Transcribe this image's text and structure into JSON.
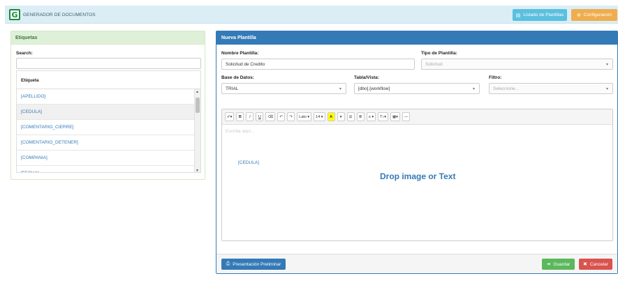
{
  "header": {
    "logo_letter": "G",
    "title": "GENERADOR DE DOCUMENTOS",
    "list_button": "Listado de Plantillas",
    "config_button": "Configuracion"
  },
  "tags_panel": {
    "title": "Etiquetas",
    "search_label": "Search:",
    "search_value": "",
    "column_header": "Etiqueta",
    "items": [
      "[APELLIDO]",
      "[CEDULA]",
      "[COMENTARIO_CIERRE]",
      "[COMENTARIO_DETENER]",
      "[COMPANIA]",
      "[FECHA]"
    ]
  },
  "template_panel": {
    "title": "Nueva Plantilla",
    "name_label": "Nombre Plantilla:",
    "name_value": "Solicitud de Credito",
    "type_label": "Tipo de Plantilla:",
    "type_value": "Solicitud",
    "db_label": "Base de Datos:",
    "db_value": "TRIAL",
    "table_label": "Tabla/Vista:",
    "table_value": "[dbo].[workflow]",
    "filter_label": "Filtro:",
    "filter_value": "Seleccione..."
  },
  "editor": {
    "toolbar": {
      "style": "✐▾",
      "bold": "B",
      "italic": "I",
      "underline": "U",
      "eraser": "⌫",
      "undo": "↶",
      "redo": "↷",
      "font": "Lato ▾",
      "size": "14 ▾",
      "color": "A",
      "color_dd": "▾",
      "ul": "☰",
      "ol": "≣",
      "align": "≡ ▾",
      "lineheight": "T↕▾",
      "table": "▦▾",
      "hr": "—"
    },
    "placeholder": "Escriba aquí...",
    "content_tag": "[CEDULA]",
    "drop_text": "Drop image or Text"
  },
  "footer": {
    "preview_button": "Presentación Preliminar",
    "save_button": "Guardar",
    "cancel_button": "Cancelar"
  },
  "colors": {
    "header_bg": "#dbeef6",
    "info": "#5bc0de",
    "warning": "#f0ad4e",
    "primary": "#337ab7",
    "success": "#5cb85c",
    "danger": "#d9534f",
    "tags_head_bg": "#dff0d8"
  },
  "icons": {
    "list": "list-icon",
    "config": "gear-icon",
    "preview": "print-icon",
    "save": "save-icon",
    "cancel": "close-icon"
  }
}
